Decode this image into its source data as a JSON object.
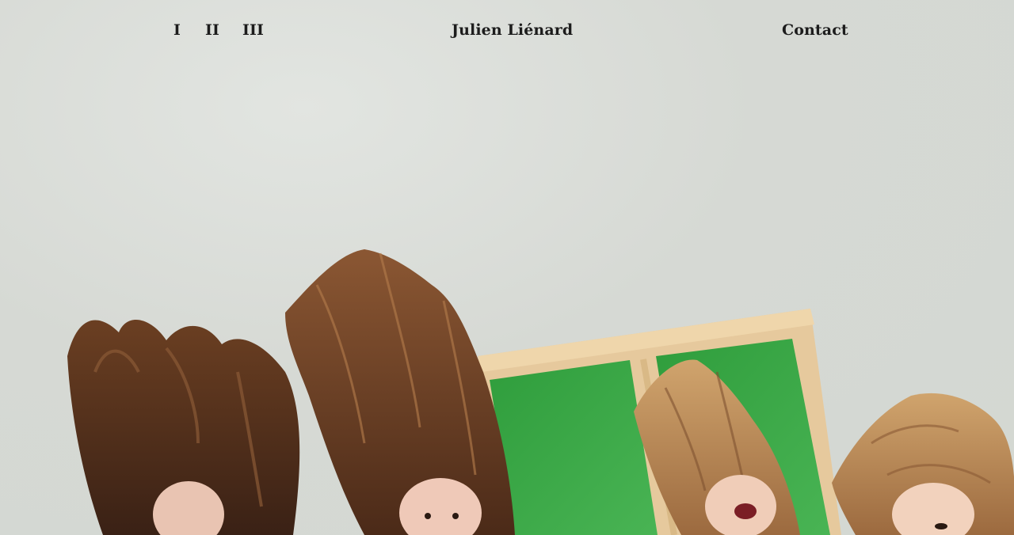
{
  "nav": {
    "items": [
      {
        "label": "I"
      },
      {
        "label": "II"
      },
      {
        "label": "III"
      }
    ],
    "brand": "Julien Liénard",
    "contact": "Contact"
  },
  "hero": {
    "image": {
      "background_color": "#d8dbd6",
      "frame_color": "#e5c99a",
      "panel_color": "#3fae48",
      "hair_dark": "#4a2a18",
      "hair_light": "#b98a52"
    }
  }
}
